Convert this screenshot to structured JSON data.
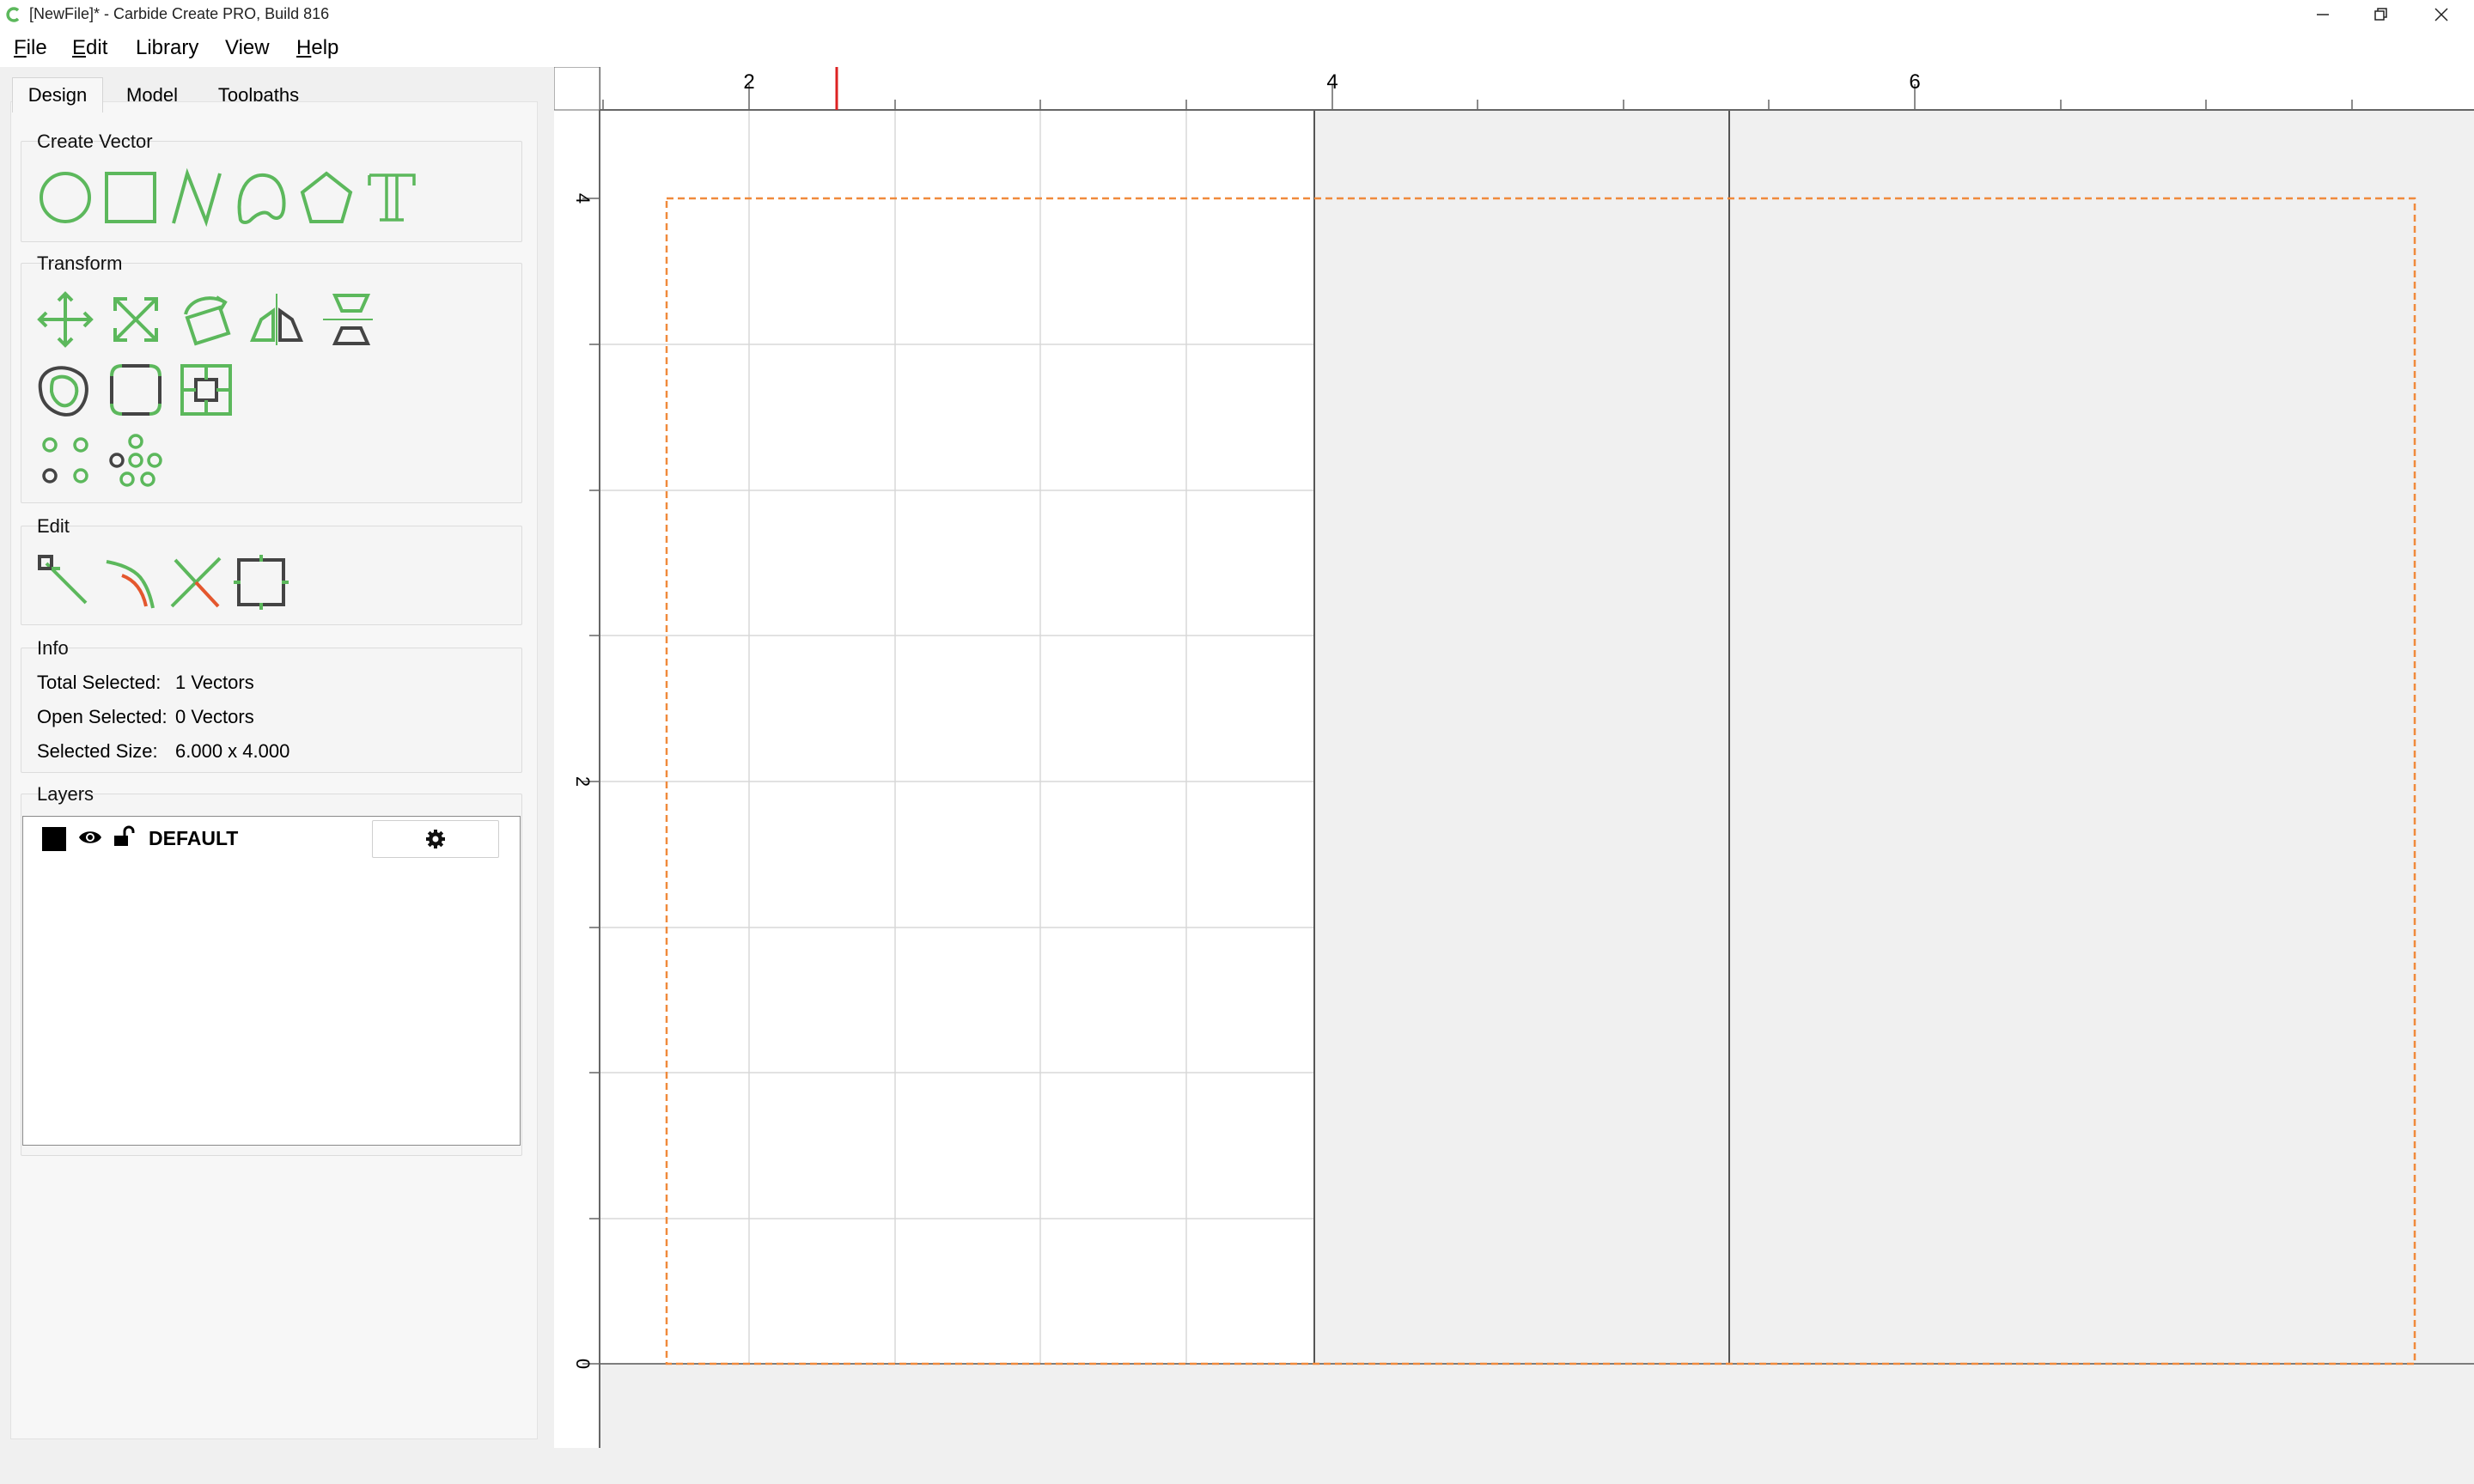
{
  "window": {
    "title": "[NewFile]* - Carbide Create PRO, Build 816",
    "controls": [
      "minimize",
      "restore",
      "close"
    ]
  },
  "menu": [
    {
      "label": "File"
    },
    {
      "label": "Edit"
    },
    {
      "label": "Library"
    },
    {
      "label": "View"
    },
    {
      "label": "Help"
    }
  ],
  "tabs": [
    {
      "label": "Design",
      "active": true
    },
    {
      "label": "Model",
      "active": false
    },
    {
      "label": "Toolpaths",
      "active": false
    }
  ],
  "sections": {
    "create_vector": "Create Vector",
    "transform": "Transform",
    "edit": "Edit",
    "info": "Info",
    "layers": "Layers"
  },
  "create_vector_tools": [
    "circle-icon",
    "rectangle-icon",
    "polyline-icon",
    "curve-icon",
    "polygon-icon",
    "text-icon"
  ],
  "transform_tools": [
    "move-icon",
    "scale-icon",
    "rotate-icon",
    "mirror-icon",
    "align-icon",
    "offset-icon",
    "fillet-icon",
    "boundary-icon",
    "linear-array-icon",
    "circular-array-icon"
  ],
  "edit_tools": [
    "node-edit-icon",
    "join-icon",
    "trim-icon",
    "bounding-box-icon"
  ],
  "info": {
    "total_selected_label": "Total Selected:",
    "total_selected_value": "1 Vectors",
    "open_selected_label": "Open Selected:",
    "open_selected_value": "0 Vectors",
    "selected_size_label": "Selected Size:",
    "selected_size_value": "6.000 x 4.000"
  },
  "layers": [
    {
      "name": "DEFAULT",
      "color": "#000000",
      "visible": true,
      "locked": false
    }
  ],
  "ruler": {
    "x_labels": [
      "2",
      "4",
      "6"
    ],
    "y_labels": [
      "4",
      "2",
      "0"
    ]
  },
  "colors": {
    "tool_green": "#5cb85c",
    "tool_dark": "#444444",
    "selection_orange": "#f08a3c",
    "ruler_marker": "#dd2222"
  }
}
